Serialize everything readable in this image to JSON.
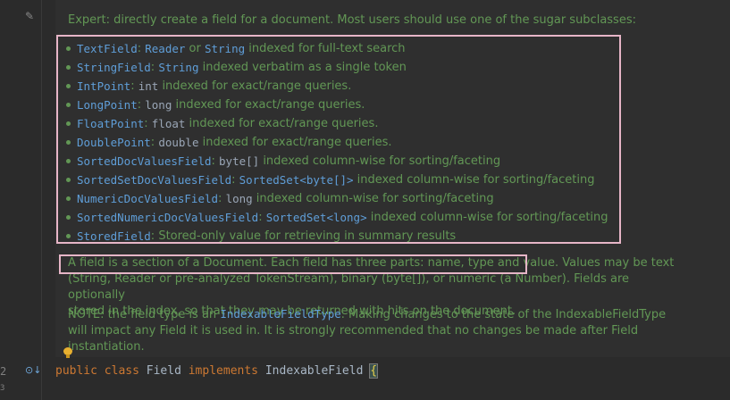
{
  "doc": {
    "intro": "Expert: directly create a field for a document. Most users should use one of the sugar subclasses:",
    "items": [
      {
        "name": "TextField",
        "sep": ": ",
        "type1": "Reader",
        "mid": " or ",
        "type2": "String",
        "desc": " indexed for full-text search"
      },
      {
        "name": "StringField",
        "sep": ": ",
        "type1": "String",
        "mid": "",
        "type2": "",
        "desc": " indexed verbatim as a single token"
      },
      {
        "name": "IntPoint",
        "sep": ": ",
        "type1": "int",
        "mid": "",
        "type2": "",
        "desc": " indexed for exact/range queries."
      },
      {
        "name": "LongPoint",
        "sep": ": ",
        "type1": "long",
        "mid": "",
        "type2": "",
        "desc": " indexed for exact/range queries."
      },
      {
        "name": "FloatPoint",
        "sep": ": ",
        "type1": "float",
        "mid": "",
        "type2": "",
        "desc": " indexed for exact/range queries."
      },
      {
        "name": "DoublePoint",
        "sep": ": ",
        "type1": "double",
        "mid": "",
        "type2": "",
        "desc": " indexed for exact/range queries."
      },
      {
        "name": "SortedDocValuesField",
        "sep": ": ",
        "type1": "byte[]",
        "mid": "",
        "type2": "",
        "desc": " indexed column-wise for sorting/faceting"
      },
      {
        "name": "SortedSetDocValuesField",
        "sep": ": ",
        "type1": "SortedSet<byte[]>",
        "mid": "",
        "type2": "",
        "desc": " indexed column-wise for sorting/faceting"
      },
      {
        "name": "NumericDocValuesField",
        "sep": ": ",
        "type1": "long",
        "mid": "",
        "type2": "",
        "desc": " indexed column-wise for sorting/faceting"
      },
      {
        "name": "SortedNumericDocValuesField",
        "sep": ": ",
        "type1": "SortedSet<long>",
        "mid": "",
        "type2": "",
        "desc": " indexed column-wise for sorting/faceting"
      },
      {
        "name": "StoredField",
        "sep": ": ",
        "type1": "",
        "mid": "",
        "type2": "",
        "desc": "Stored-only value for retrieving in summary results"
      }
    ],
    "para1_line1": "A field is a section of a Document. Each field has three parts: name, type and value. Values may be text",
    "para1_line2": "(String, Reader or pre-analyzed TokenStream), binary (byte[]), or numeric (a Number). Fields are optionally",
    "para1_line3": "stored in the index, so that they may be returned with hits on the document.",
    "para2_prefix": "NOTE: the field type is an ",
    "para2_code": "IndexableFieldType",
    "para2_rest": ". Making changes to the state of the IndexableFieldType",
    "para2_line2": "will impact any Field it is used in. It is strongly recommended that no changes be made after Field",
    "para2_line3": "instantiation."
  },
  "code": {
    "line_number": "2",
    "line_number_next": "3",
    "kw_public": "public",
    "kw_class": "class",
    "class_name": "Field",
    "kw_implements": "implements",
    "iface": "IndexableField",
    "brace": "{"
  },
  "gutter": {
    "pencil_icon": "✎",
    "implements_icon": "⊙↓"
  },
  "colors": {
    "doc_green": "#629755",
    "link_blue": "#5f9ed8",
    "keyword": "#cc7832",
    "highlight_border": "#e6b5c7"
  }
}
